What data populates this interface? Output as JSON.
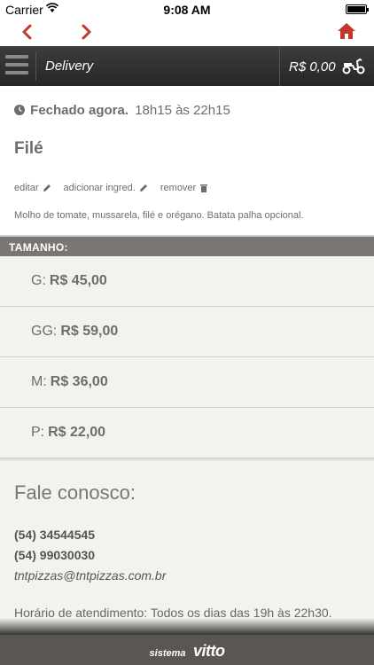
{
  "status_bar": {
    "carrier": "Carrier",
    "time": "9:08 AM"
  },
  "nav": {
    "back_icon": "chevron-left-icon",
    "forward_icon": "chevron-right-icon",
    "home_icon": "home-icon",
    "accent_color": "#c0392b"
  },
  "app_bar": {
    "title": "Delivery",
    "cart_total": "R$ 0,00",
    "cart_icon": "scooter-icon"
  },
  "product": {
    "status_label": "Fechado agora.",
    "hours": "18h15 às 22h15",
    "name": "Filé",
    "actions": {
      "edit": "editar",
      "add_ingredient": "adicionar ingred.",
      "remove": "remover"
    },
    "description": "Molho de tomate, mussarela, filé e orégano. Batata palha opcional."
  },
  "sizes": {
    "header": "TAMANHO:",
    "items": [
      {
        "label": "G:",
        "price": "R$ 45,00"
      },
      {
        "label": "GG:",
        "price": "R$ 59,00"
      },
      {
        "label": "M:",
        "price": "R$ 36,00"
      },
      {
        "label": "P:",
        "price": "R$ 22,00"
      }
    ]
  },
  "contact": {
    "title": "Fale conosco:",
    "phones": [
      "(54) 34544545",
      "(54) 99030030"
    ],
    "email": "tntpizzas@tntpizzas.com.br",
    "hours": "Horário de atendimento: Todos os dias das 19h às 22h30."
  },
  "footer": {
    "prefix": "sistema",
    "brand": "vitto"
  }
}
